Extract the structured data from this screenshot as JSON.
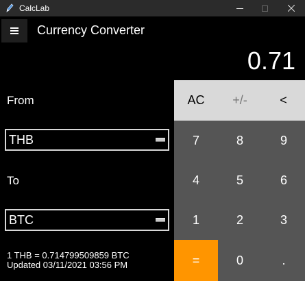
{
  "window": {
    "title": "CalcLab",
    "controls": {
      "minimize": "minimize-icon",
      "maximize": "maximize-icon",
      "close": "close-icon"
    }
  },
  "header": {
    "menu_icon": "hamburger-menu-icon",
    "title": "Currency Converter"
  },
  "display": {
    "value": "0.71"
  },
  "converter": {
    "from_label": "From",
    "from_value": "THB",
    "to_label": "To",
    "to_value": "BTC",
    "rate_text": "1 THB = 0.714799509859 BTC",
    "updated_text": "Updated 03/11/2021 03:56 PM"
  },
  "keypad": {
    "clear": "AC",
    "sign": "+/-",
    "backspace": "<",
    "k7": "7",
    "k8": "8",
    "k9": "9",
    "k4": "4",
    "k5": "5",
    "k6": "6",
    "k1": "1",
    "k2": "2",
    "k3": "3",
    "equals": "=",
    "k0": "0",
    "decimal": "."
  },
  "colors": {
    "background": "#000000",
    "titlebar": "#2b2b2b",
    "keypad": "#555555",
    "top_keys": "#d9d9d9",
    "equals_key": "#ff9500",
    "close_hover": "#ffffff"
  }
}
